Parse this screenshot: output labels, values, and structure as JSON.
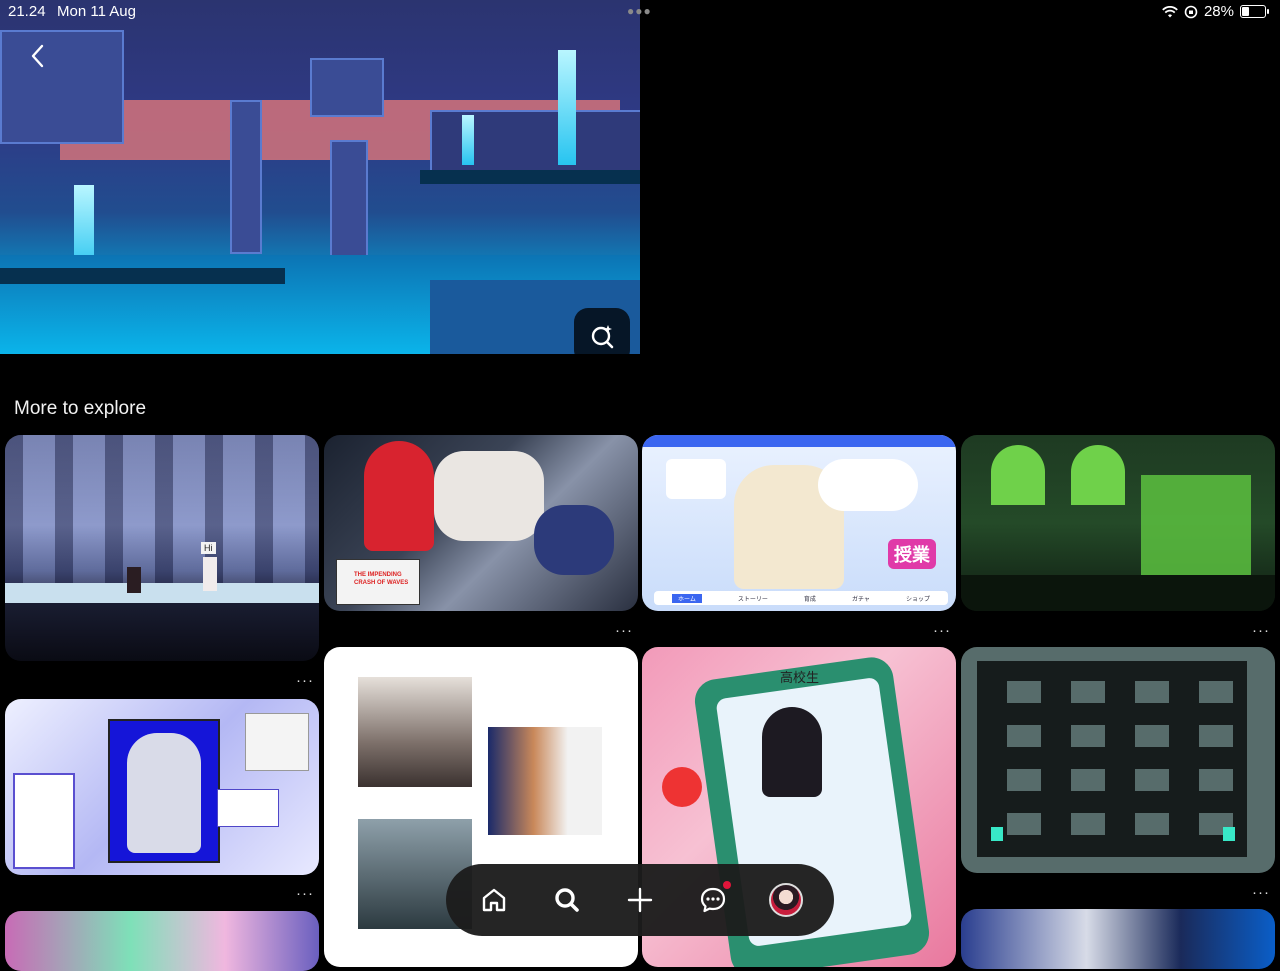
{
  "status_bar": {
    "time": "21.24",
    "date": "Mon 11 Aug",
    "battery": "28%",
    "battery_level": 0.28
  },
  "hero": {
    "icons": [
      "back-chevron-icon",
      "visual-search-icon"
    ]
  },
  "section": {
    "title": "More to explore"
  },
  "pins": [
    {
      "id": "pin-1",
      "theme": "pixel forest scene",
      "texts": [
        "Hi"
      ]
    },
    {
      "id": "pin-2",
      "theme": "anime maids artwork",
      "texts": [
        "THE IMPENDING CRASH OF WAVES"
      ]
    },
    {
      "id": "pin-3",
      "theme": "anime game UI",
      "texts": [
        "授業",
        "ホーム",
        "ストーリー",
        "育成",
        "ガチャ",
        "ショップ"
      ]
    },
    {
      "id": "pin-4",
      "theme": "green pixel ruins",
      "texts": []
    },
    {
      "id": "pin-5",
      "theme": "retro desktop anime",
      "texts": []
    },
    {
      "id": "pin-6",
      "theme": "sketch panels",
      "texts": []
    },
    {
      "id": "pin-7",
      "theme": "anime phone collage",
      "texts": [
        "高校生"
      ]
    },
    {
      "id": "pin-8",
      "theme": "dark level map",
      "texts": []
    }
  ],
  "more_label": "···",
  "nav": {
    "items": [
      "home-icon",
      "search-icon",
      "create-plus-icon",
      "messages-icon",
      "profile-avatar"
    ],
    "has_notification": true
  },
  "colors": {
    "background": "#000000",
    "nav_bg": "#1c1c1c",
    "notification": "#e0153a"
  }
}
